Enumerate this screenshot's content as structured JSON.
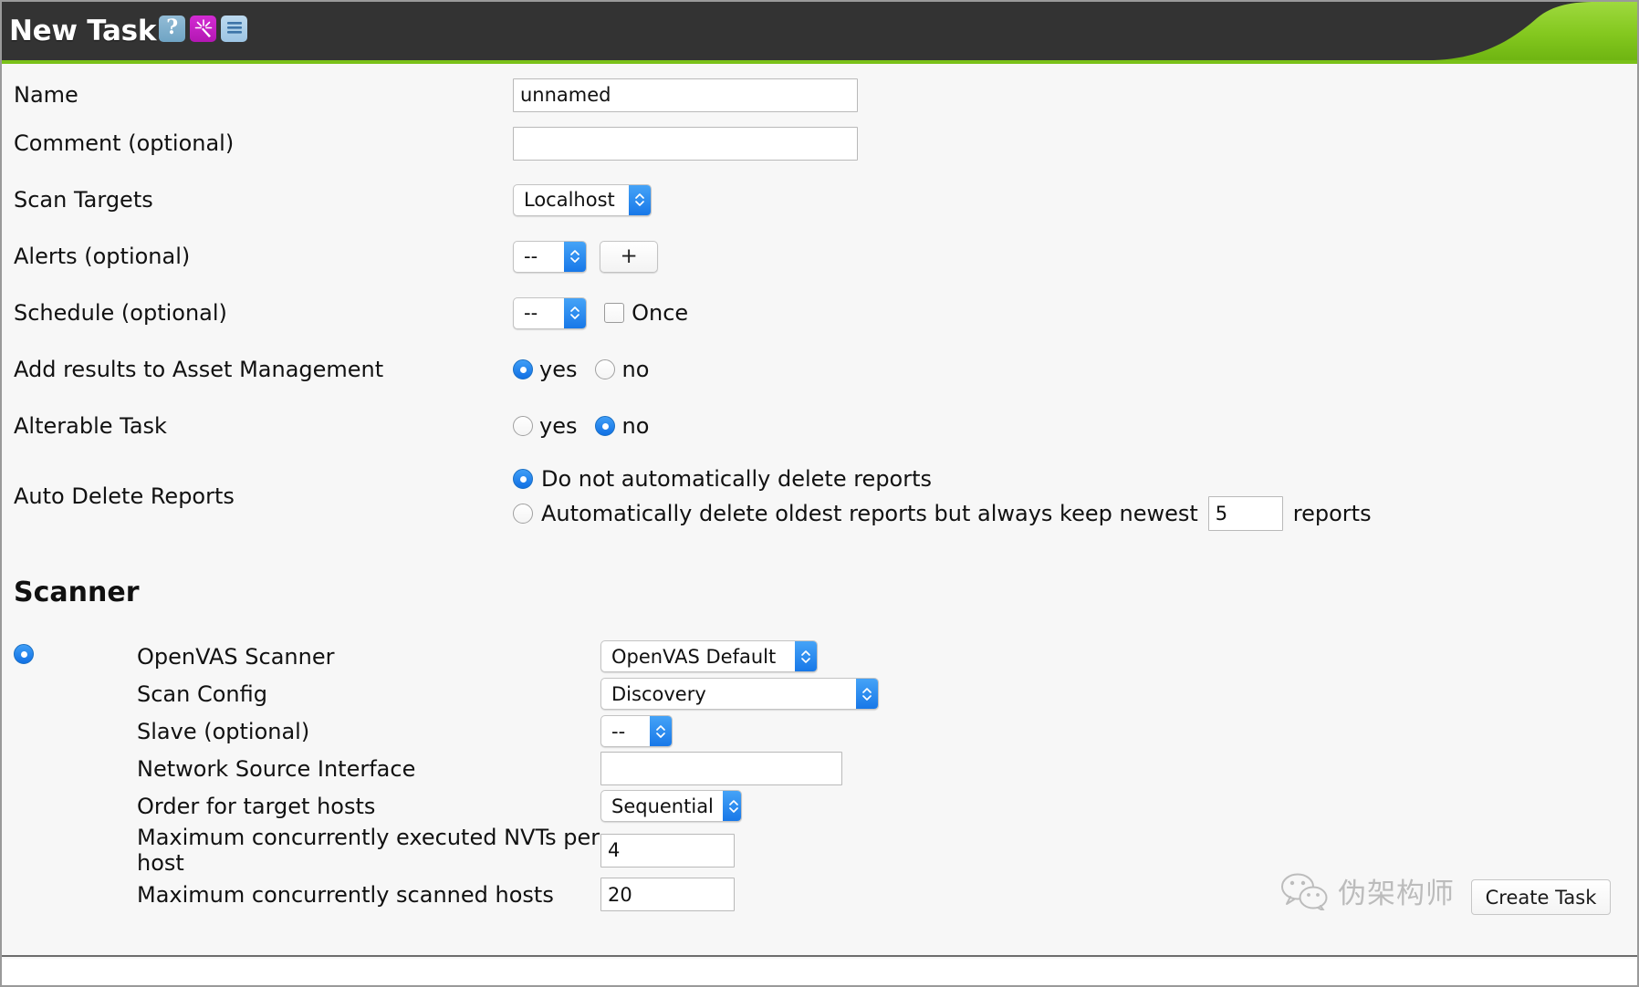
{
  "header": {
    "title": "New Task",
    "icons": [
      {
        "name": "help-icon",
        "glyph": "?"
      },
      {
        "name": "wand-icon",
        "glyph": "✳"
      },
      {
        "name": "list-icon",
        "glyph": "☰"
      }
    ]
  },
  "form": {
    "name": {
      "label": "Name",
      "value": "unnamed"
    },
    "comment": {
      "label": "Comment (optional)",
      "value": ""
    },
    "scan_targets": {
      "label": "Scan Targets",
      "value": "Localhost"
    },
    "alerts": {
      "label": "Alerts (optional)",
      "value": "--",
      "add_label": "+"
    },
    "schedule": {
      "label": "Schedule (optional)",
      "value": "--",
      "once_label": "Once",
      "once_checked": false
    },
    "asset_management": {
      "label": "Add results to Asset Management",
      "yes_label": "yes",
      "no_label": "no",
      "selected": "yes"
    },
    "alterable_task": {
      "label": "Alterable Task",
      "yes_label": "yes",
      "no_label": "no",
      "selected": "no"
    },
    "auto_delete": {
      "label": "Auto Delete Reports",
      "option_never": "Do not automatically delete reports",
      "option_keep_prefix": "Automatically delete oldest reports but always keep newest",
      "option_keep_suffix": "reports",
      "keep_value": "5",
      "selected": "never"
    }
  },
  "scanner": {
    "section_title": "Scanner",
    "selected": "openvas",
    "openvas_scanner": {
      "label": "OpenVAS Scanner",
      "value": "OpenVAS Default"
    },
    "scan_config": {
      "label": "Scan Config",
      "value": "Discovery"
    },
    "slave": {
      "label": "Slave (optional)",
      "value": "--"
    },
    "network_source_interface": {
      "label": "Network Source Interface",
      "value": ""
    },
    "order_for_target_hosts": {
      "label": "Order for target hosts",
      "value": "Sequential"
    },
    "max_nvts": {
      "label": "Maximum concurrently executed NVTs per host",
      "value": "4"
    },
    "max_hosts": {
      "label": "Maximum concurrently scanned hosts",
      "value": "20"
    }
  },
  "footer": {
    "create_button": "Create Task"
  },
  "watermark": {
    "text": "伪架构师",
    "icon": "wechat-icon"
  },
  "colors": {
    "header_bg": "#333333",
    "accent_green": "#7ac119",
    "accent_blue": "#1878e8",
    "page_bg": "#f7f7f7"
  }
}
